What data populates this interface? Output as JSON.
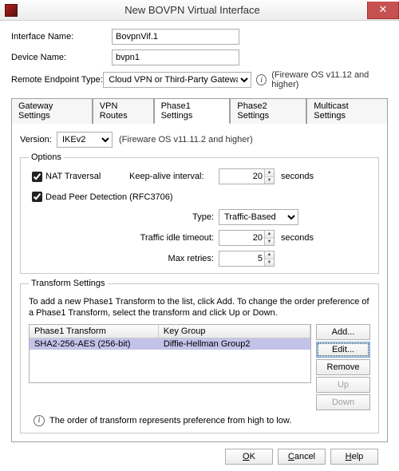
{
  "window": {
    "title": "New BOVPN Virtual Interface"
  },
  "form": {
    "ifname_label": "Interface Name:",
    "ifname_value": "BovpnVif.1",
    "devname_label": "Device Name:",
    "devname_value": "bvpn1",
    "endpoint_label": "Remote Endpoint Type:",
    "endpoint_value": "Cloud VPN or Third-Party Gateway",
    "endpoint_note": "(Fireware OS v11.12 and higher)"
  },
  "tabs": {
    "t0": "Gateway Settings",
    "t1": "VPN Routes",
    "t2": "Phase1 Settings",
    "t3": "Phase2 Settings",
    "t4": "Multicast Settings"
  },
  "phase1": {
    "version_label": "Version:",
    "version_value": "IKEv2",
    "version_note": "(Fireware OS v11.11.2 and higher)",
    "options_legend": "Options",
    "nat_label": "NAT Traversal",
    "keepalive_label": "Keep-alive interval:",
    "keepalive_value": "20",
    "seconds": "seconds",
    "dpd_label": "Dead Peer Detection (RFC3706)",
    "type_label": "Type:",
    "type_value": "Traffic-Based",
    "idle_label": "Traffic idle timeout:",
    "idle_value": "20",
    "retries_label": "Max retries:",
    "retries_value": "5",
    "transform_legend": "Transform Settings",
    "transform_help": "To add a new Phase1 Transform to the list, click Add. To change the order preference of a Phase1 Transform, select the transform and click Up or Down.",
    "col_transform": "Phase1 Transform",
    "col_keygroup": "Key Group",
    "row0_transform": "SHA2-256-AES (256-bit)",
    "row0_keygroup": "Diffie-Hellman Group2",
    "btn_add": "Add...",
    "btn_edit": "Edit...",
    "btn_remove": "Remove",
    "btn_up": "Up",
    "btn_down": "Down",
    "hint": "The order of transform represents preference from high to low."
  },
  "dialog": {
    "ok": "OK",
    "cancel": "Cancel",
    "help": "Help"
  }
}
